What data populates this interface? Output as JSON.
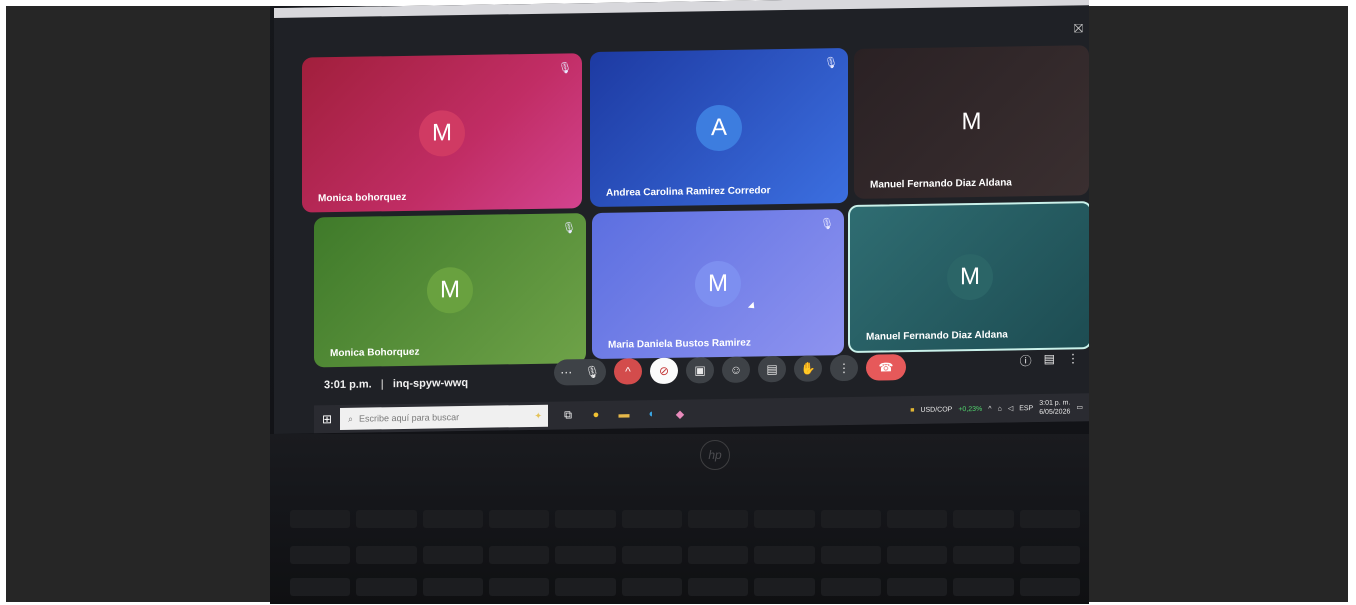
{
  "participants": [
    {
      "initial": "M",
      "name": "Monica bohorquez",
      "muted": true
    },
    {
      "initial": "A",
      "name": "Andrea Carolina Ramirez Corredor",
      "muted": true
    },
    {
      "initial": "M",
      "name": "Manuel Fernando Diaz Aldana",
      "muted": false
    },
    {
      "initial": "M",
      "name": "Monica Bohorquez",
      "muted": true
    },
    {
      "initial": "M",
      "name": "Maria Daniela Bustos Ramirez",
      "muted": true
    },
    {
      "initial": "M",
      "name": "Manuel Fernando Diaz Aldana",
      "muted": false
    }
  ],
  "meeting": {
    "time": "3:01 p.m.",
    "separator": "|",
    "code": "inq-spyw-wwq"
  },
  "controls": {
    "more": "⋯",
    "mic": "🎙",
    "caret": "^",
    "camera": "⊘",
    "present": "▣",
    "emoji": "☺",
    "captions": "▤",
    "hand": "✋",
    "overflow": "⋮",
    "hangup": "☎"
  },
  "right_controls": {
    "info": "ⓘ",
    "chat": "▤",
    "activities": "⋮"
  },
  "taskbar": {
    "search_placeholder": "Escribe aquí para buscar",
    "sparkle": "✦",
    "currency": "USD/COP",
    "change": "+0,23%",
    "lang": "ESP",
    "clock_time": "3:01 p. m.",
    "clock_date": "6/05/2026"
  },
  "logo": "hp"
}
